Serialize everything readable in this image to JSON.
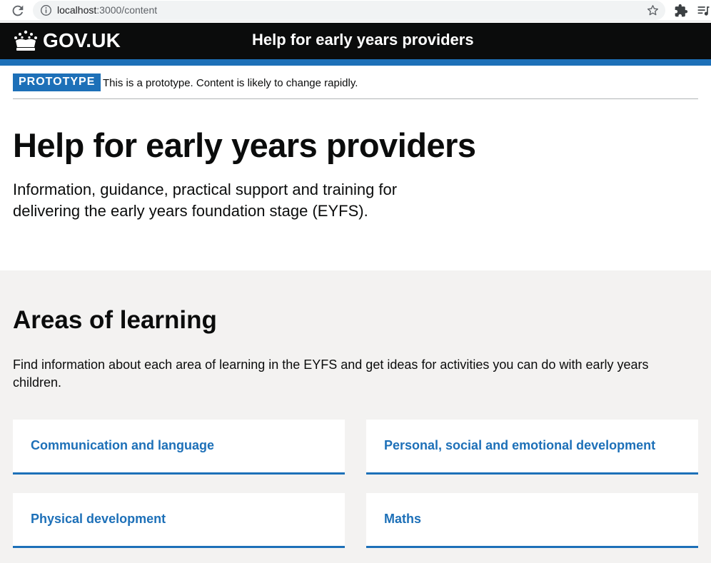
{
  "browser": {
    "url_host": "localhost",
    "url_path": ":3000/content"
  },
  "header": {
    "logo_text": "GOV.UK",
    "service_name": "Help for early years providers"
  },
  "phase_banner": {
    "tag": "PROTOTYPE",
    "text": "This is a prototype. Content is likely to change rapidly."
  },
  "hero": {
    "title": "Help for early years providers",
    "lede": "Information, guidance, practical support and training for delivering the early years foundation stage (EYFS)."
  },
  "areas": {
    "heading": "Areas of learning",
    "intro": "Find information about each area of learning in the EYFS and get ideas for activities you can do with early years children.",
    "cards": [
      {
        "label": "Communication and language"
      },
      {
        "label": "Personal, social and emotional development"
      },
      {
        "label": "Physical development"
      },
      {
        "label": "Maths"
      }
    ]
  },
  "colors": {
    "header_bg": "#0b0c0c",
    "brand_blue": "#1d70b8",
    "section_bg": "#f3f2f1"
  }
}
